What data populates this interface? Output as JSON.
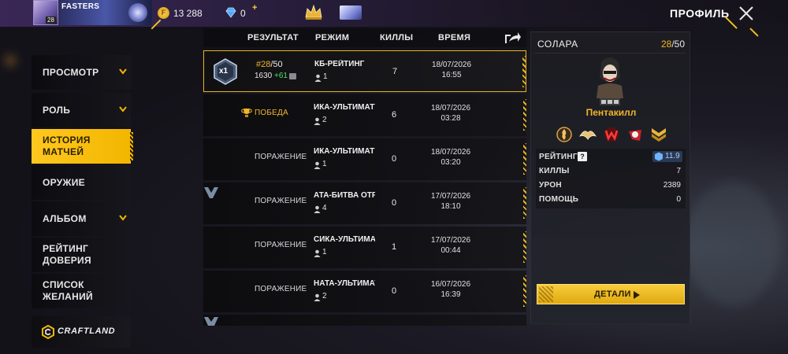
{
  "topbar": {
    "player_name": "FASTERS",
    "level": "28",
    "coins": "13 288",
    "diamonds": "0",
    "diamonds_add": "+",
    "page_title": "ПРОФИЛЬ"
  },
  "sidebar": {
    "items": [
      {
        "label": "ПРОСМОТР",
        "has_chevron": true
      },
      {
        "label": "РОЛЬ",
        "has_chevron": true
      },
      {
        "label": "ИСТОРИЯ МАТЧЕЙ",
        "active": true
      },
      {
        "label": "ОРУЖИЕ"
      },
      {
        "label": "АЛЬБОМ",
        "has_chevron": true
      },
      {
        "label": "РЕЙТИНГ ДОВЕРИЯ"
      },
      {
        "label": "СПИСОК ЖЕЛАНИЙ"
      }
    ],
    "craftland": "CRAFTLAND"
  },
  "table": {
    "headers": {
      "result": "РЕЗУЛЬТАТ",
      "mode": "РЕЖИМ",
      "kills": "КИЛЛЫ",
      "time": "ВРЕМЯ"
    },
    "rows": [
      {
        "rank_badge": "x1",
        "rank": "#28",
        "rank_total": "/50",
        "score": "1630",
        "score_delta": "+61",
        "mode": "КБ-РЕЙТИНГ",
        "squad": "1",
        "kills": "7",
        "date": "18/07/2026",
        "time": "16:55"
      },
      {
        "result": "ПОБЕДА",
        "mode": "ИКА-УЛЬТИМАТУ",
        "squad": "2",
        "kills": "6",
        "date": "18/07/2026",
        "time": "03:28"
      },
      {
        "result": "ПОРАЖЕНИЕ",
        "mode": "ИКА-УЛЬТИМАТ",
        "squad": "1",
        "kills": "0",
        "date": "18/07/2026",
        "time": "03:20"
      },
      {
        "result": "ПОРАЖЕНИЕ",
        "mode": "АТА-БИТВА ОТРЯ",
        "squad": "4",
        "kills": "0",
        "date": "17/07/2026",
        "time": "18:10"
      },
      {
        "result": "ПОРАЖЕНИЕ",
        "mode": "СИКА-УЛЬТИМАТ",
        "squad": "1",
        "kills": "1",
        "date": "17/07/2026",
        "time": "00:44"
      },
      {
        "result": "ПОРАЖЕНИЕ",
        "mode": "НАТА-УЛЬТИМАТ",
        "squad": "2",
        "kills": "0",
        "date": "16/07/2026",
        "time": "16:39"
      }
    ]
  },
  "panel": {
    "title": "СОЛАРА",
    "count_current": "28",
    "count_total": "/50",
    "character_name": "Пентакилл",
    "stats": {
      "rating_label": "РЕЙТИНГ",
      "help": "?",
      "rating_value": "11.9",
      "kills_label": "КИЛЛЫ",
      "kills_value": "7",
      "damage_label": "УРОН",
      "damage_value": "2389",
      "assists_label": "ПОМОЩЬ",
      "assists_value": "0"
    },
    "details_button": "ДЕТАЛИ"
  },
  "colors": {
    "accent": "#f2b600",
    "win": "#f0b62a",
    "positive": "#48e06a"
  }
}
